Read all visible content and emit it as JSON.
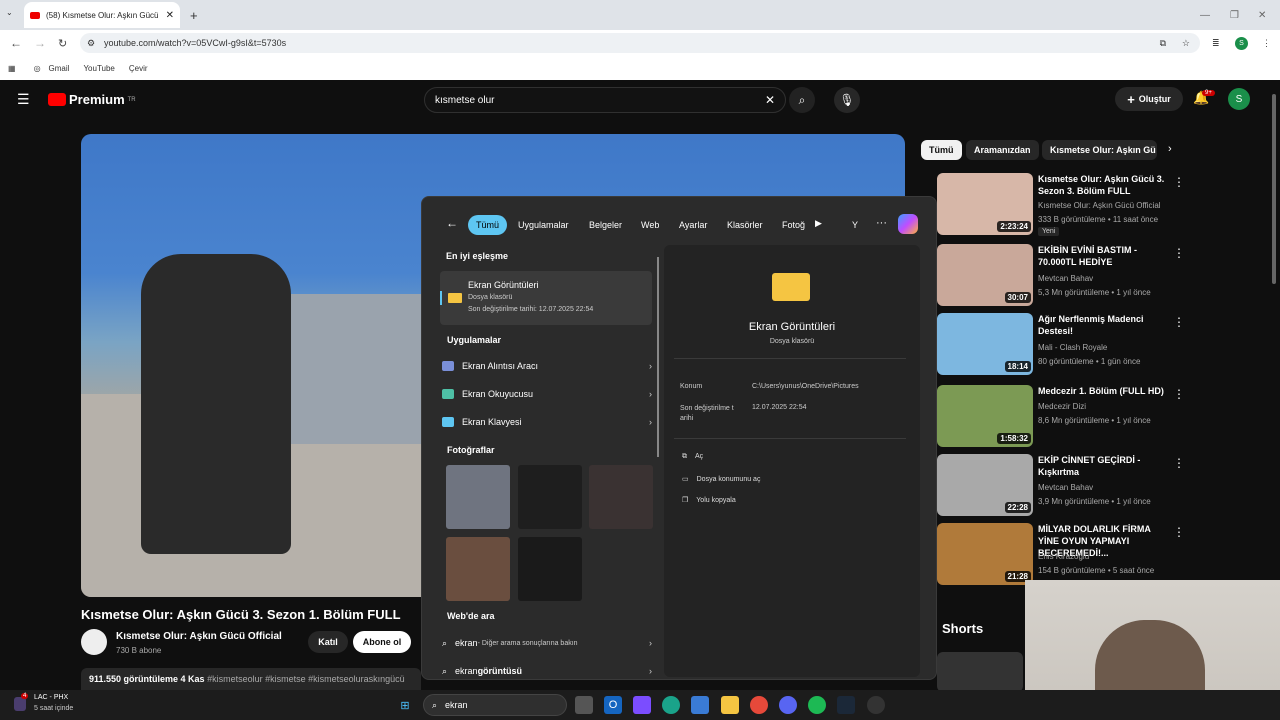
{
  "browser": {
    "tab_title": "(58) Kısmetse Olur: Aşkın Gücü",
    "url": "youtube.com/watch?v=05VCwI-g9sI&t=5730s",
    "bookmarks": [
      "Gmail",
      "YouTube",
      "Çevir"
    ]
  },
  "yt": {
    "logo": "Premium",
    "logo_sup": "TR",
    "search_value": "kısmetse olur",
    "create": "Oluştur",
    "notif": "9+",
    "avatar": "S"
  },
  "chips": [
    "Tümü",
    "Aramanızdan",
    "Kısmetse Olur: Aşkın Gü"
  ],
  "video": {
    "title": "Kısmetse Olur: Aşkın Gücü 3. Sezon 1. Bölüm FULL",
    "channel": "Kısmetse Olur: Aşkın Gücü Official",
    "subs": "730 B abone",
    "join": "Katıl",
    "subscribe": "Abone ol",
    "stats": "911.550 görüntüleme  4 Kas",
    "tags": "#kismetseolur #kismetse #kismetseoluraskıngücü"
  },
  "related": [
    {
      "title": "Kısmetse Olur: Aşkın Gücü 3. Sezon 3. Bölüm FULL",
      "channel": "Kısmetse Olur: Aşkın Gücü Official",
      "meta": "333 B görüntüleme • 11 saat önce",
      "badge": "Yeni",
      "dur": "2:23:24",
      "color": "#d7b7a8"
    },
    {
      "title": "EKİBİN EVİNİ BASTIM - 70.000TL HEDİYE",
      "channel": "Mevtcan Bahav",
      "meta": "5,3 Mn görüntüleme • 1 yıl önce",
      "dur": "30:07",
      "color": "#c9a89a"
    },
    {
      "title": "Ağır Nerflenmiş Madenci Destesi!",
      "channel": "Mali - Clash Royale",
      "meta": "80 görüntüleme • 1 gün önce",
      "dur": "18:14",
      "color": "#7db7e0"
    },
    {
      "title": "Medcezir 1. Bölüm (FULL HD)",
      "channel": "Medcezir Dizi",
      "meta": "8,6 Mn görüntüleme • 1 yıl önce",
      "dur": "1:58:32",
      "color": "#7c9a54"
    },
    {
      "title": "EKİP CİNNET GEÇİRDİ - Kışkırtma",
      "channel": "Mevtcan Bahav",
      "meta": "3,9 Mn görüntüleme • 1 yıl önce",
      "dur": "22:28",
      "color": "#a9a9a9"
    },
    {
      "title": "MİLYAR DOLARLIK FİRMA YİNE OYUN YAPMAYI BECEREMEDİ!...",
      "channel": "Enis Kirazoglu",
      "meta": "154 B görüntüleme • 5 saat önce",
      "dur": "21:28",
      "color": "#b07a3a"
    }
  ],
  "shorts": "Shorts",
  "winsearch": {
    "filters": [
      "Tümü",
      "Uygulamalar",
      "Belgeler",
      "Web",
      "Ayarlar",
      "Klasörler",
      "Fotoğ",
      "Y"
    ],
    "best_match": "En iyi eşleşme",
    "best_title": "Ekran Görüntüleri",
    "best_sub": "Dosya klasörü",
    "best_date": "Son değiştirilme tarihi: 12.07.2025 22:54",
    "apps_head": "Uygulamalar",
    "apps": [
      "Ekran Alıntısı Aracı",
      "Ekran Okuyucusu",
      "Ekran Klavyesi"
    ],
    "photos_head": "Fotoğraflar",
    "web_head": "Web'de ara",
    "web1": "ekran",
    "web1b": " - Diğer arama sonuçlarına bakın",
    "web2a": "ekran ",
    "web2b": "görüntüsü",
    "detail_title": "Ekran Görüntüleri",
    "detail_sub": "Dosya klasörü",
    "loc_label": "Konum",
    "loc_val": "C:\\Users\\yunus\\OneDrive\\Pictures",
    "mod_label": "Son değiştirilme t arihi",
    "mod_val": "12.07.2025 22:54",
    "actions": [
      "Aç",
      "Dosya konumunu aç",
      "Yolu kopyala"
    ]
  },
  "taskbar": {
    "weather": "LAC - PHX",
    "weather_sub": "5 saat içinde",
    "search": "ekran",
    "badge": "4"
  }
}
